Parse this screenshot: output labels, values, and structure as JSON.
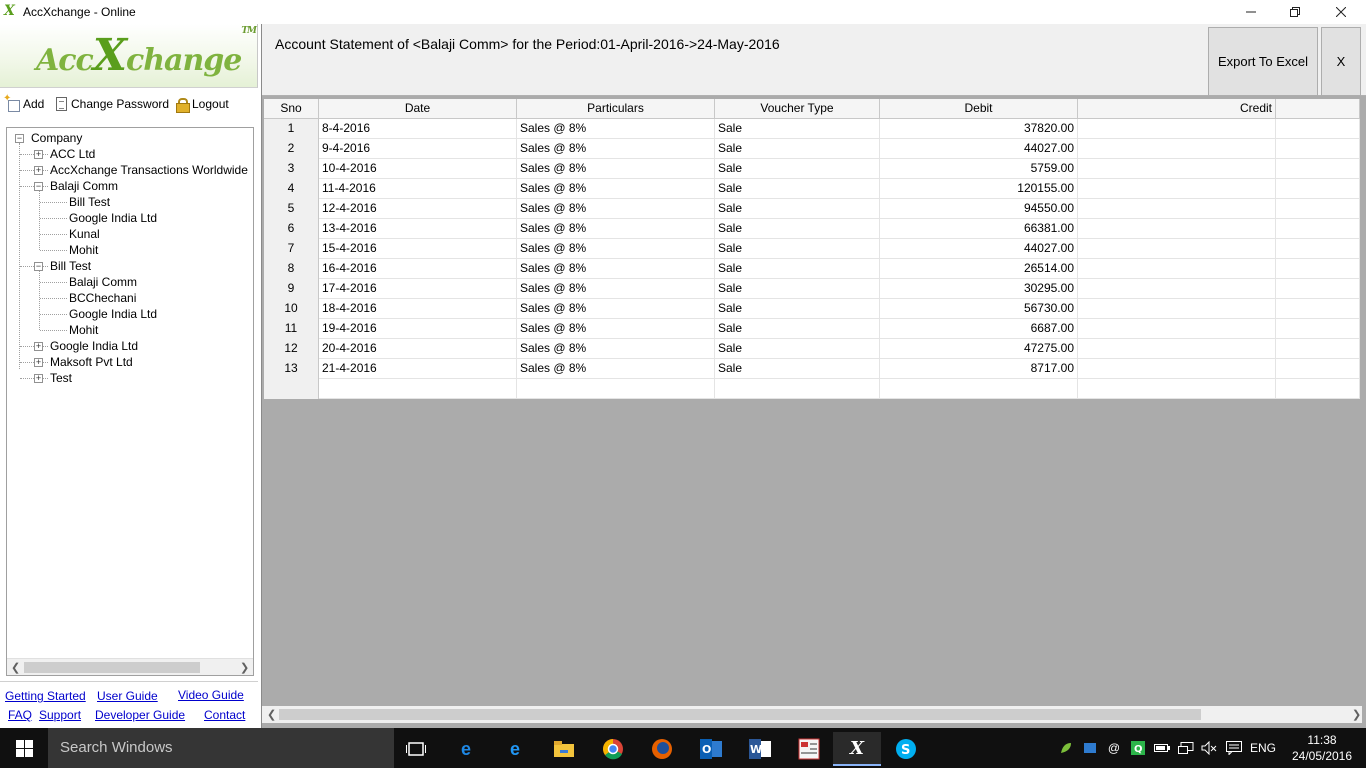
{
  "window": {
    "title": "AccXchange - Online",
    "min_icon": "minimize-icon",
    "max_icon": "restore-icon",
    "close_icon": "close-icon"
  },
  "logo": {
    "prefix": "Acc",
    "x": "X",
    "suffix": "change",
    "tm": "TM"
  },
  "toolbar": {
    "add": "Add",
    "change_password": "Change Password",
    "logout": "Logout"
  },
  "tree": {
    "root": "Company",
    "items": [
      {
        "label": "ACC Ltd",
        "level": 1,
        "toggle": "+"
      },
      {
        "label": "AccXchange Transactions Worldwide",
        "level": 1,
        "toggle": "+"
      },
      {
        "label": "Balaji Comm",
        "level": 1,
        "toggle": "−"
      },
      {
        "label": "Bill Test",
        "level": 2,
        "toggle": ""
      },
      {
        "label": "Google India Ltd",
        "level": 2,
        "toggle": ""
      },
      {
        "label": "Kunal",
        "level": 2,
        "toggle": ""
      },
      {
        "label": "Mohit",
        "level": 2,
        "toggle": ""
      },
      {
        "label": "Bill Test",
        "level": 1,
        "toggle": "−"
      },
      {
        "label": "Balaji Comm",
        "level": 2,
        "toggle": ""
      },
      {
        "label": "BCChechani",
        "level": 2,
        "toggle": ""
      },
      {
        "label": "Google India Ltd",
        "level": 2,
        "toggle": ""
      },
      {
        "label": "Mohit",
        "level": 2,
        "toggle": ""
      },
      {
        "label": "Google India Ltd",
        "level": 1,
        "toggle": "+"
      },
      {
        "label": "Maksoft Pvt Ltd",
        "level": 1,
        "toggle": "+"
      },
      {
        "label": "Test",
        "level": 1,
        "toggle": "+"
      }
    ]
  },
  "links": {
    "getting_started": "Getting Started",
    "user_guide": "User Guide",
    "video_guide": "Video Guide",
    "faq": "FAQ",
    "support": "Support",
    "developer_guide": "Developer Guide",
    "contact": "Contact"
  },
  "header": {
    "title": "Account Statement of <Balaji Comm> for the Period:01-April-2016->24-May-2016",
    "export_label": "Export To Excel",
    "close_label": "X"
  },
  "table": {
    "columns": [
      "Sno",
      "Date",
      "Particulars",
      "Voucher Type",
      "Debit",
      "Credit"
    ],
    "rows": [
      [
        "1",
        "8-4-2016",
        "Sales @ 8%",
        "Sale",
        "37820.00",
        ""
      ],
      [
        "2",
        "9-4-2016",
        "Sales @ 8%",
        "Sale",
        "44027.00",
        ""
      ],
      [
        "3",
        "10-4-2016",
        "Sales @ 8%",
        "Sale",
        "5759.00",
        ""
      ],
      [
        "4",
        "11-4-2016",
        "Sales @ 8%",
        "Sale",
        "120155.00",
        ""
      ],
      [
        "5",
        "12-4-2016",
        "Sales @ 8%",
        "Sale",
        "94550.00",
        ""
      ],
      [
        "6",
        "13-4-2016",
        "Sales @ 8%",
        "Sale",
        "66381.00",
        ""
      ],
      [
        "7",
        "15-4-2016",
        "Sales @ 8%",
        "Sale",
        "44027.00",
        ""
      ],
      [
        "8",
        "16-4-2016",
        "Sales @ 8%",
        "Sale",
        "26514.00",
        ""
      ],
      [
        "9",
        "17-4-2016",
        "Sales @ 8%",
        "Sale",
        "30295.00",
        ""
      ],
      [
        "10",
        "18-4-2016",
        "Sales @ 8%",
        "Sale",
        "56730.00",
        ""
      ],
      [
        "11",
        "19-4-2016",
        "Sales @ 8%",
        "Sale",
        "6687.00",
        ""
      ],
      [
        "12",
        "20-4-2016",
        "Sales @ 8%",
        "Sale",
        "47275.00",
        ""
      ],
      [
        "13",
        "21-4-2016",
        "Sales @ 8%",
        "Sale",
        "8717.00",
        ""
      ]
    ]
  },
  "taskbar": {
    "search_placeholder": "Search Windows",
    "apps": [
      "task-view-icon",
      "edge-icon",
      "ie-icon",
      "file-explorer-icon",
      "chrome-icon",
      "firefox-icon",
      "outlook-icon",
      "word-icon",
      "tally-icon",
      "accxchange-icon",
      "skype-icon"
    ],
    "language": "ENG",
    "time": "11:38",
    "date": "24/05/2016"
  }
}
